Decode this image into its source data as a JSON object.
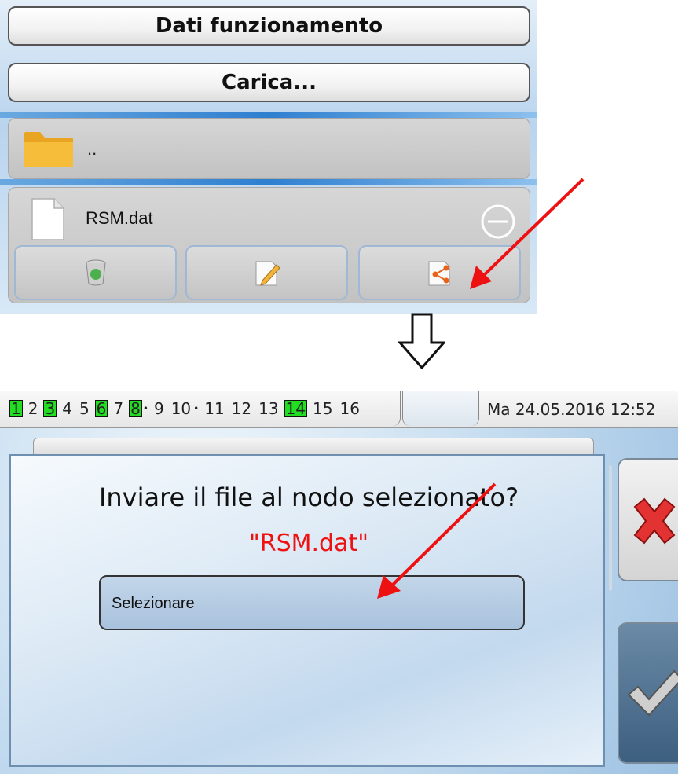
{
  "top_panel": {
    "title": "Dati funzionamento",
    "load_button": "Carica...",
    "parent_dir_label": "..",
    "file_name": "RSM.dat",
    "actions": [
      "delete",
      "edit",
      "send"
    ]
  },
  "status_bar": {
    "nodes": [
      {
        "n": "1",
        "active": true
      },
      {
        "n": "2",
        "active": false
      },
      {
        "n": "3",
        "active": true
      },
      {
        "n": "4",
        "active": false
      },
      {
        "n": "5",
        "active": false
      },
      {
        "n": "6",
        "active": true
      },
      {
        "n": "7",
        "active": false
      },
      {
        "n": "8",
        "active": true,
        "dot_after": true
      },
      {
        "n": "9",
        "active": false
      },
      {
        "n": "10",
        "active": false,
        "dot_after": true
      },
      {
        "n": "11",
        "active": false
      },
      {
        "n": "12",
        "active": false
      },
      {
        "n": "13",
        "active": false
      },
      {
        "n": "14",
        "active": true
      },
      {
        "n": "15",
        "active": false
      },
      {
        "n": "16",
        "active": false
      }
    ],
    "datetime": "Ma 24.05.2016 12:52"
  },
  "dialog": {
    "question": "Inviare il file al nodo selezionato?",
    "file_name": "\"RSM.dat\"",
    "select_placeholder": "Selezionare"
  },
  "colors": {
    "active_node": "#22dd22",
    "filename_red": "#ee1111",
    "annotation_arrow": "#ee1111"
  }
}
